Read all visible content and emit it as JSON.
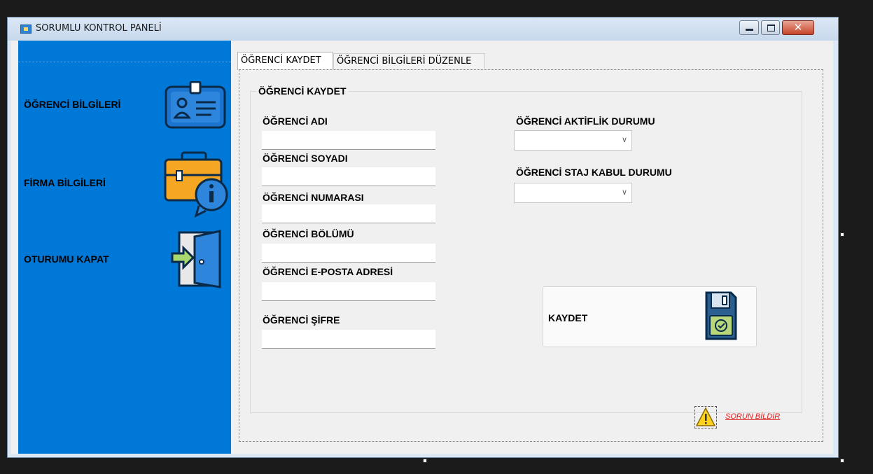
{
  "window": {
    "title": "SORUMLU KONTROL PANELİ",
    "close_glyph": "✕"
  },
  "sidebar": {
    "items": [
      {
        "label": "ÖĞRENCİ BİLGİLERİ",
        "icon": "student-id-card-icon"
      },
      {
        "label": "FİRMA BİLGİLERİ",
        "icon": "briefcase-info-icon"
      },
      {
        "label": "OTURUMU KAPAT",
        "icon": "logout-door-icon"
      }
    ]
  },
  "tabs": [
    {
      "label": "ÖĞRENCİ KAYDET",
      "active": true
    },
    {
      "label": "ÖĞRENCİ BİLGİLERİ DÜZENLE",
      "active": false
    }
  ],
  "form": {
    "group_title": "ÖĞRENCİ KAYDET",
    "fields": [
      {
        "label": "ÖĞRENCİ ADI",
        "value": ""
      },
      {
        "label": "ÖĞRENCİ SOYADI",
        "value": ""
      },
      {
        "label": "ÖĞRENCİ NUMARASI",
        "value": ""
      },
      {
        "label": "ÖĞRENCİ BÖLÜMÜ",
        "value": ""
      },
      {
        "label": "ÖĞRENCİ E-POSTA ADRESİ",
        "value": ""
      },
      {
        "label": "ÖĞRENCİ ŞİFRE",
        "value": ""
      }
    ],
    "combos": [
      {
        "label": "ÖĞRENCİ AKTİFLİK DURUMU",
        "value": ""
      },
      {
        "label": "ÖĞRENCİ STAJ KABUL DURUMU",
        "value": ""
      }
    ],
    "save_label": "KAYDET",
    "report_link": "SORUN BİLDİR"
  },
  "colors": {
    "sidebar": "#0078d7",
    "link": "#e02020",
    "icon_blue": "#1b74d0",
    "icon_orange": "#f5a623",
    "warning": "#ffd21f"
  }
}
